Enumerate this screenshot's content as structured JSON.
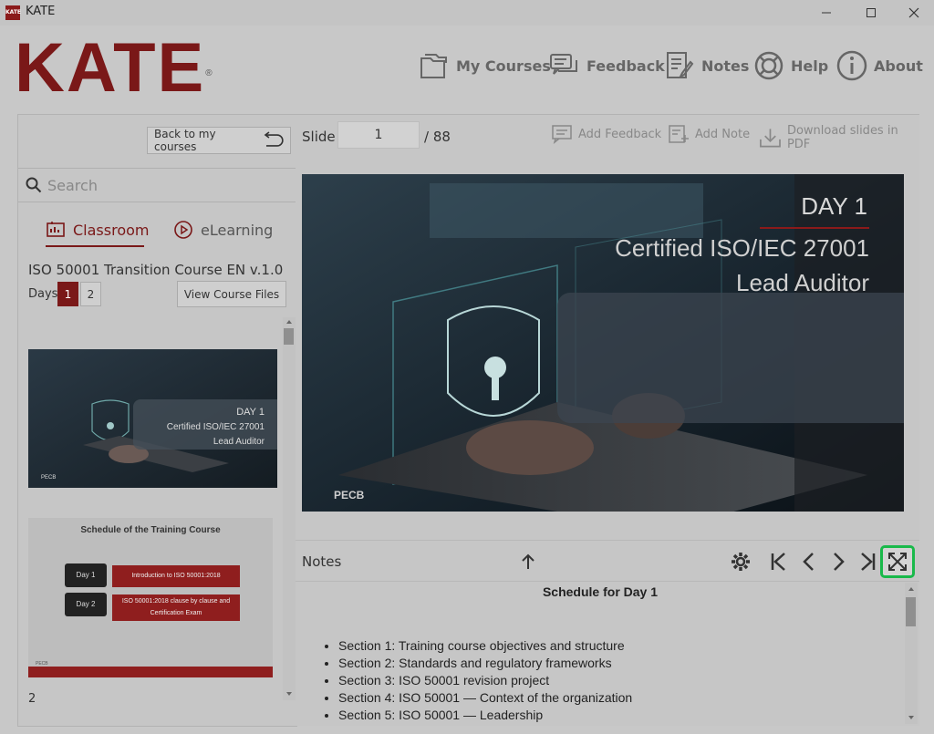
{
  "window": {
    "title": "KATE",
    "app_icon_label": "KATE",
    "minimize": "—",
    "maximize": "☐",
    "close": "✕"
  },
  "logo": {
    "text": "KATE",
    "mark": "®"
  },
  "topnav": [
    {
      "label": "My Courses",
      "icon": "folder-icon"
    },
    {
      "label": "Feedback",
      "icon": "chat-icon"
    },
    {
      "label": "Notes",
      "icon": "notes-icon"
    },
    {
      "label": "Help",
      "icon": "lifebuoy-icon"
    },
    {
      "label": "About",
      "icon": "info-icon"
    }
  ],
  "sidebar": {
    "back_label": "Back to my courses",
    "search_placeholder": "Search",
    "tabs": [
      {
        "label": "Classroom",
        "active": true
      },
      {
        "label": "eLearning",
        "active": false
      }
    ],
    "course_title": "ISO 50001 Transition Course  EN v.1.0",
    "days_label": "Days",
    "days": [
      "1",
      "2"
    ],
    "files_button": "View Course Files",
    "thumb1": {
      "day": "DAY 1",
      "line2": "Certified ISO/IEC 27001",
      "line3": "Lead Auditor",
      "brand": "PECB"
    },
    "thumb2": {
      "title": "Schedule of the Training Course",
      "row1_day": "Day 1",
      "row1_text": "Introduction to ISO 50001:2018",
      "row2_day": "Day 2",
      "row2_text": "ISO 50001:2018 clause by clause and Certification Exam",
      "brand": "PECB"
    },
    "page_number": "2"
  },
  "slidebar": {
    "slide_label": "Slide",
    "slide_value": "1",
    "slide_total": "/ 88",
    "add_feedback": "Add Feedback",
    "add_note": "Add Note",
    "download": "Download slides in PDF"
  },
  "slide": {
    "day": "DAY 1",
    "line2": "Certified ISO/IEC 27001",
    "line3": "Lead Auditor",
    "brand": "PECB"
  },
  "notes": {
    "label": "Notes",
    "title": "Schedule for Day 1",
    "items": [
      "Section 1: Training course objectives and structure",
      "Section 2: Standards and regulatory frameworks",
      "Section 3: ISO 50001 revision project",
      "Section 4: ISO 50001 — Context of the organization",
      "Section 5: ISO 50001 — Leadership"
    ]
  },
  "colors": {
    "brand": "#7a1818",
    "highlight": "#19b94a"
  }
}
